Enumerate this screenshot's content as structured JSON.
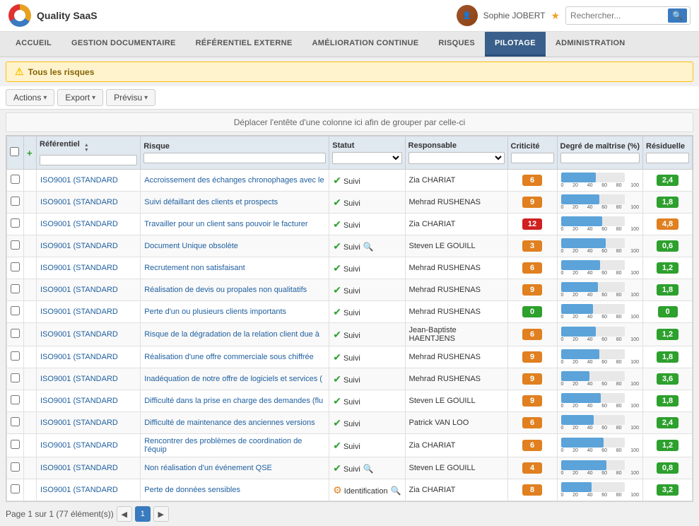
{
  "app": {
    "logo_text": "Quality SaaS",
    "user_name": "Sophie JOBERT",
    "search_placeholder": "Rechercher..."
  },
  "nav": {
    "items": [
      {
        "label": "ACCUEIL",
        "active": false
      },
      {
        "label": "GESTION DOCUMENTAIRE",
        "active": false
      },
      {
        "label": "RÉFÉRENTIEL EXTERNE",
        "active": false
      },
      {
        "label": "AMÉLIORATION CONTINUE",
        "active": false
      },
      {
        "label": "RISQUES",
        "active": false
      },
      {
        "label": "PILOTAGE",
        "active": true
      },
      {
        "label": "ADMINISTRATION",
        "active": false
      }
    ]
  },
  "alert": {
    "text": "Tous les risques"
  },
  "toolbar": {
    "actions_label": "Actions",
    "export_label": "Export",
    "previsu_label": "Prévisu"
  },
  "group_header": "Déplacer l'entête d'une colonne ici afin de grouper par celle-ci",
  "table": {
    "columns": [
      "Référentiel",
      "Risque",
      "Statut",
      "Responsable",
      "Criticité",
      "Degré de maîtrise (%)",
      "Résiduelle"
    ],
    "rows": [
      {
        "ref": "ISO9001 (STANDARD",
        "risque": "Accroissement des échanges chronophages avec le",
        "statut": "check",
        "statut_label": "Suivi",
        "icon2": "",
        "responsable": "Zia CHARIAT",
        "criticite": "6",
        "crit_color": "orange",
        "maitrise": 55,
        "residuelle": "2,4",
        "res_color": "green"
      },
      {
        "ref": "ISO9001 (STANDARD",
        "risque": "Suivi défaillant des clients et prospects",
        "statut": "check",
        "statut_label": "Suivi",
        "icon2": "",
        "responsable": "Mehrad RUSHENAS",
        "criticite": "9",
        "crit_color": "orange",
        "maitrise": 60,
        "residuelle": "1,8",
        "res_color": "green"
      },
      {
        "ref": "ISO9001 (STANDARD",
        "risque": "Travailler pour un client sans pouvoir le facturer",
        "statut": "check",
        "statut_label": "Suivi",
        "icon2": "",
        "responsable": "Zia CHARIAT",
        "criticite": "12",
        "crit_color": "red",
        "maitrise": 65,
        "residuelle": "4,8",
        "res_color": "orange"
      },
      {
        "ref": "ISO9001 (STANDARD",
        "risque": "Document Unique obsolète",
        "statut": "check",
        "statut_label": "Suivi",
        "icon2": "search",
        "responsable": "Steven LE GOUILL",
        "criticite": "3",
        "crit_color": "orange",
        "maitrise": 70,
        "residuelle": "0,6",
        "res_color": "green"
      },
      {
        "ref": "ISO9001 (STANDARD",
        "risque": "Recrutement non satisfaisant",
        "statut": "check",
        "statut_label": "Suivi",
        "icon2": "",
        "responsable": "Mehrad RUSHENAS",
        "criticite": "6",
        "crit_color": "orange",
        "maitrise": 62,
        "residuelle": "1,2",
        "res_color": "green"
      },
      {
        "ref": "ISO9001 (STANDARD",
        "risque": "Réalisation de devis ou propales non qualitatifs",
        "statut": "check",
        "statut_label": "Suivi",
        "icon2": "",
        "responsable": "Mehrad RUSHENAS",
        "criticite": "9",
        "crit_color": "orange",
        "maitrise": 58,
        "residuelle": "1,8",
        "res_color": "green"
      },
      {
        "ref": "ISO9001 (STANDARD",
        "risque": "Perte d'un ou plusieurs clients importants",
        "statut": "check",
        "statut_label": "Suivi",
        "icon2": "",
        "responsable": "Mehrad RUSHENAS",
        "criticite": "0",
        "crit_color": "green",
        "maitrise": 50,
        "residuelle": "0",
        "res_color": "green"
      },
      {
        "ref": "ISO9001 (STANDARD",
        "risque": "Risque de la dégradation de la relation client due à",
        "statut": "check",
        "statut_label": "Suivi",
        "icon2": "",
        "responsable": "Jean-Baptiste HAENTJENS",
        "criticite": "6",
        "crit_color": "orange",
        "maitrise": 55,
        "residuelle": "1,2",
        "res_color": "green"
      },
      {
        "ref": "ISO9001 (STANDARD",
        "risque": "Réalisation d'une offre commerciale sous chiffrée",
        "statut": "check",
        "statut_label": "Suivi",
        "icon2": "",
        "responsable": "Mehrad RUSHENAS",
        "criticite": "9",
        "crit_color": "orange",
        "maitrise": 60,
        "residuelle": "1,8",
        "res_color": "green"
      },
      {
        "ref": "ISO9001 (STANDARD",
        "risque": "Inadéquation de notre offre de logiciels et services (",
        "statut": "check",
        "statut_label": "Suivi",
        "icon2": "",
        "responsable": "Mehrad RUSHENAS",
        "criticite": "9",
        "crit_color": "orange",
        "maitrise": 45,
        "residuelle": "3,6",
        "res_color": "green"
      },
      {
        "ref": "ISO9001 (STANDARD",
        "risque": "Difficulté dans la prise en charge des demandes (flu",
        "statut": "check",
        "statut_label": "Suivi",
        "icon2": "",
        "responsable": "Steven LE GOUILL",
        "criticite": "9",
        "crit_color": "orange",
        "maitrise": 63,
        "residuelle": "1,8",
        "res_color": "green"
      },
      {
        "ref": "ISO9001 (STANDARD",
        "risque": "Difficulté de maintenance des anciennes versions",
        "statut": "check",
        "statut_label": "Suivi",
        "icon2": "",
        "responsable": "Patrick VAN LOO",
        "criticite": "6",
        "crit_color": "orange",
        "maitrise": 52,
        "residuelle": "2,4",
        "res_color": "green"
      },
      {
        "ref": "ISO9001 (STANDARD",
        "risque": "Rencontrer des problèmes de coordination de l'équip",
        "statut": "check",
        "statut_label": "Suivi",
        "icon2": "",
        "responsable": "Zia CHARIAT",
        "criticite": "6",
        "crit_color": "orange",
        "maitrise": 67,
        "residuelle": "1,2",
        "res_color": "green"
      },
      {
        "ref": "ISO9001 (STANDARD",
        "risque": "Non réalisation d'un événement QSE",
        "statut": "check",
        "statut_label": "Suivi",
        "icon2": "search",
        "responsable": "Steven LE GOUILL",
        "criticite": "4",
        "crit_color": "orange",
        "maitrise": 72,
        "residuelle": "0,8",
        "res_color": "green"
      },
      {
        "ref": "ISO9001 (STANDARD",
        "risque": "Perte de données sensibles",
        "statut": "gear",
        "statut_label": "Identification",
        "icon2": "search",
        "responsable": "Zia CHARIAT",
        "criticite": "8",
        "crit_color": "orange",
        "maitrise": 48,
        "residuelle": "3,2",
        "res_color": "green"
      }
    ]
  },
  "pagination": {
    "text": "Page 1 sur 1 (77 élément(s))",
    "current_page": "1"
  }
}
